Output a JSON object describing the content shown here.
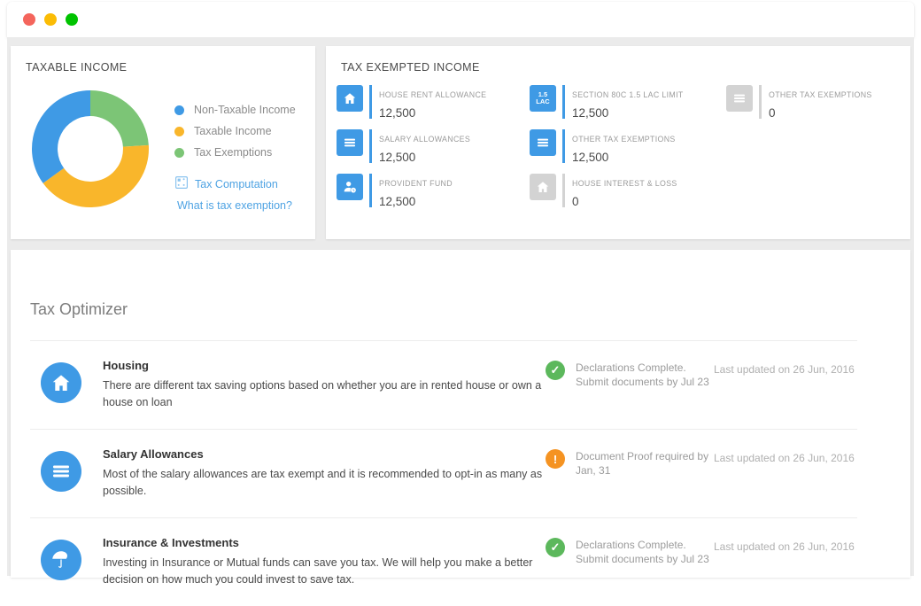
{
  "window": {
    "buttons": [
      {
        "name": "close-button",
        "color": "#f4655c"
      },
      {
        "name": "minimize-button",
        "color": "#fbbc05"
      },
      {
        "name": "maximize-button",
        "color": "#00c300"
      }
    ]
  },
  "taxable_income": {
    "title": "TAXABLE INCOME",
    "links": {
      "computation": "Tax Computation",
      "exemption": "What is tax exemption?"
    }
  },
  "chart_data": {
    "type": "pie",
    "variant": "donut",
    "title": "TAXABLE INCOME",
    "legend_position": "right",
    "categories": [
      "Non-Taxable Income",
      "Taxable Income",
      "Tax Exemptions"
    ],
    "values": [
      35,
      41,
      24
    ],
    "colors": [
      "#3f9ae5",
      "#f9b62b",
      "#7cc576"
    ],
    "units": "percent",
    "inner_radius_ratio": 0.56
  },
  "tax_exempted": {
    "title": "TAX EXEMPTED INCOME",
    "items": [
      {
        "icon": "home-icon",
        "label": "HOUSE RENT ALLOWANCE",
        "value": "12,500",
        "disabled": false
      },
      {
        "icon": "badge-1-5-lac",
        "label": "SECTION 80C 1.5 LAC LIMIT",
        "value": "12,500",
        "disabled": false,
        "badge_line1": "1.5",
        "badge_line2": "LAC"
      },
      {
        "icon": "list-icon",
        "label": "OTHER TAX EXEMPTIONS",
        "value": "0",
        "disabled": true
      },
      {
        "icon": "list-icon",
        "label": "SALARY ALLOWANCES",
        "value": "12,500",
        "disabled": false
      },
      {
        "icon": "list-icon",
        "label": "OTHER TAX EXEMPTIONS",
        "value": "12,500",
        "disabled": false
      },
      {
        "icon": "spacer",
        "label": "",
        "value": "",
        "disabled": false
      },
      {
        "icon": "person-icon",
        "label": "PROVIDENT FUND",
        "value": "12,500",
        "disabled": false
      },
      {
        "icon": "home-icon",
        "label": "HOUSE INTEREST & LOSS",
        "value": "0",
        "disabled": true
      },
      {
        "icon": "spacer",
        "label": "",
        "value": "",
        "disabled": false
      }
    ]
  },
  "tax_optimizer": {
    "title": "Tax Optimizer",
    "rows": [
      {
        "icon": "home-icon",
        "name": "Housing",
        "description": "There are different tax saving options based on whether you are in rented house or own a house on loan",
        "status_type": "ok",
        "status_glyph": "✓",
        "status_text": "Declarations Complete. Submit documents by Jul 23",
        "updated": "Last updated on 26 Jun, 2016"
      },
      {
        "icon": "list-icon",
        "name": "Salary Allowances",
        "description": "Most of the salary allowances are tax exempt and it is recommended to opt-in as many as possible.",
        "status_type": "warn",
        "status_glyph": "!",
        "status_text": "Document Proof required by Jan, 31",
        "updated": "Last updated on 26 Jun, 2016"
      },
      {
        "icon": "umbrella-icon",
        "name": "Insurance & Investments",
        "description": "Investing in Insurance or Mutual funds can save you tax. We will help you make a better decision on how much you could invest to save tax.",
        "status_type": "ok",
        "status_glyph": "✓",
        "status_text": "Declarations Complete. Submit documents by Jul 23",
        "updated": "Last updated on 26 Jun, 2016"
      }
    ]
  },
  "colors": {
    "accent_blue": "#3f9ae5",
    "link_blue": "#4fa3e3",
    "orange": "#f9b62b",
    "green": "#7cc576",
    "status_ok": "#5cb85c",
    "status_warn": "#f59322",
    "page_bg": "#ebebeb",
    "disabled_gray": "#d3d3d3"
  }
}
